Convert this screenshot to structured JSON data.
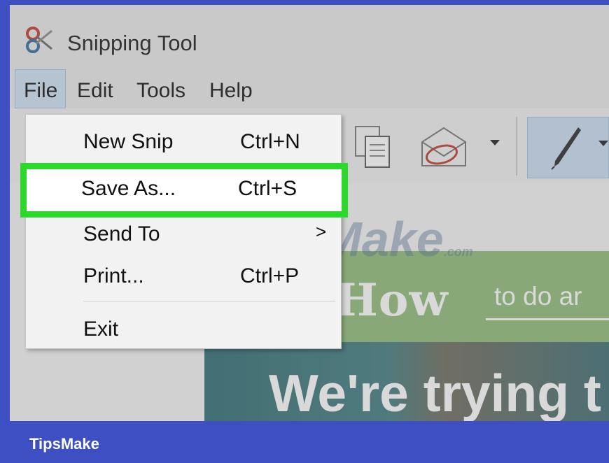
{
  "window": {
    "title": "Snipping Tool",
    "app_icon": "scissors-icon"
  },
  "menubar": {
    "items": [
      "File",
      "Edit",
      "Tools",
      "Help"
    ],
    "active": "File"
  },
  "toolbar": {
    "icons": [
      "copy-icon",
      "send-snip-icon",
      "dropdown-arrow-icon",
      "pen-icon",
      "pen-dropdown-icon"
    ]
  },
  "file_menu": {
    "items": [
      {
        "label": "New Snip",
        "shortcut": "Ctrl+N"
      },
      {
        "label": "Save As...",
        "shortcut": "Ctrl+S",
        "highlighted": true
      },
      {
        "label": "Send To",
        "submenu_arrow": ">"
      },
      {
        "label": "Print...",
        "shortcut": "Ctrl+P"
      },
      {
        "label": "Exit"
      }
    ]
  },
  "snip_content": {
    "logo": "iHow",
    "tagline": "to do ar",
    "headline": "We're trying t"
  },
  "watermark": {
    "text": "TipsMake",
    "suffix": ".com"
  },
  "footer": {
    "brand": "TipsMake"
  },
  "colors": {
    "frame_blue": "#3d4fc2",
    "highlight_green": "#2bd82b",
    "menu_active": "#cfe2f5",
    "web_green": "#8fbd78"
  }
}
